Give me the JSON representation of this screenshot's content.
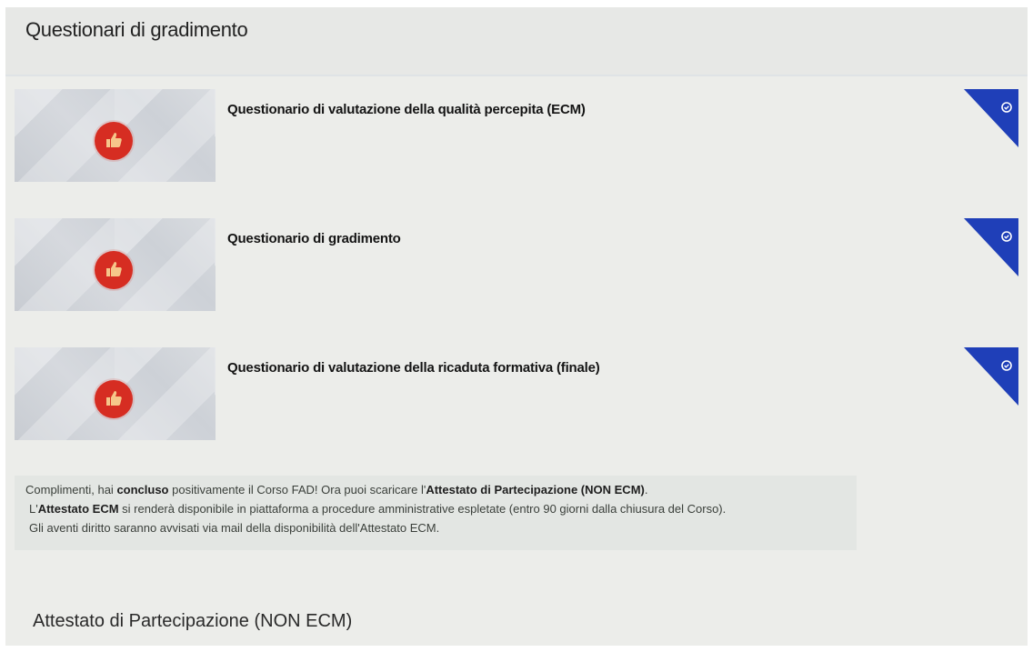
{
  "header": {
    "title": "Questionari di gradimento"
  },
  "questionnaires": [
    {
      "title": "Questionario di valutazione della qualità percepita (ECM)",
      "status_icon": "check-circle-icon",
      "thumb_icon": "thumbs-up-icon"
    },
    {
      "title": "Questionario di gradimento",
      "status_icon": "check-circle-icon",
      "thumb_icon": "thumbs-up-icon"
    },
    {
      "title": "Questionario di valutazione della ricaduta formativa (finale)",
      "status_icon": "check-circle-icon",
      "thumb_icon": "thumbs-up-icon"
    }
  ],
  "notice": {
    "line1_a": "Complimenti, hai ",
    "line1_b": "concluso",
    "line1_c": " positivamente il Corso FAD! Ora puoi scaricare l'",
    "line1_d": "Attestato di Partecipazione (NON ECM)",
    "line1_e": ".",
    "line2_a": "L'",
    "line2_b": "Attestato ECM",
    "line2_c": " si renderà disponibile in piattaforma a procedure amministrative espletate (entro 90 giorni dalla chiusura del Corso).",
    "line3": "Gli aventi diritto saranno avvisati via mail della disponibilità dell'Attestato ECM."
  },
  "section": {
    "title": "Attestato di Partecipazione (NON ECM)"
  },
  "colors": {
    "accent_red": "#d62d22",
    "ribbon_blue": "#1f3fb8",
    "notice_bg": "#e3e6e3"
  }
}
